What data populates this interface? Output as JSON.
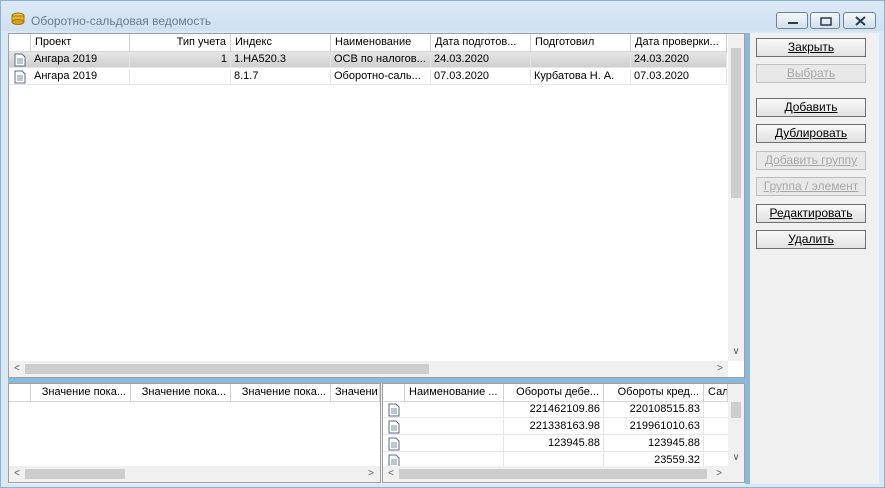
{
  "window": {
    "title": "Оборотно-сальдовая ведомость",
    "minimize_icon": "minimize-icon",
    "restore_icon": "restore-icon",
    "close_icon": "close-icon"
  },
  "main_table": {
    "columns": [
      "Проект",
      "Тип учета",
      "Индекс",
      "Наименование",
      "Дата подготов...",
      "Подготовил",
      "Дата проверки..."
    ],
    "rows": [
      {
        "project": "Ангара 2019",
        "type": "1",
        "index": "1.НА520.3",
        "name": "ОСВ по налогов...",
        "prep_date": "24.03.2020",
        "prepared_by": "",
        "check_date": "24.03.2020"
      },
      {
        "project": "Ангара 2019",
        "type": "",
        "index": "8.1.7",
        "name": "Оборотно-саль...",
        "prep_date": "07.03.2020",
        "prepared_by": "Курбатова Н. А.",
        "check_date": "07.03.2020"
      }
    ]
  },
  "bottom_left_table": {
    "columns": [
      "Значение пока...",
      "Значение пока...",
      "Значение пока...",
      "Значени"
    ]
  },
  "bottom_right_table": {
    "columns": [
      "Наименование ...",
      "Обороты дебе...",
      "Обороты кред...",
      "Сал"
    ],
    "rows": [
      {
        "name": "",
        "debit": "221462109.86",
        "credit": "220108515.83"
      },
      {
        "name": "",
        "debit": "221338163.98",
        "credit": "219961010.63"
      },
      {
        "name": "",
        "debit": "123945.88",
        "credit": "123945.88"
      },
      {
        "name": "",
        "debit": "",
        "credit": "23559.32"
      }
    ]
  },
  "buttons": {
    "close": "Закрыть",
    "select": "Выбрать",
    "add": "Добавить",
    "duplicate": "Дублировать",
    "add_group": "Добавить группу",
    "group_element": "Группа / элемент",
    "edit": "Редактировать",
    "delete": "Удалить"
  },
  "colors": {
    "splitter": "#8ab9d9",
    "window_frame": "#d9e8f5",
    "selected_row": "#d8d8d8"
  }
}
